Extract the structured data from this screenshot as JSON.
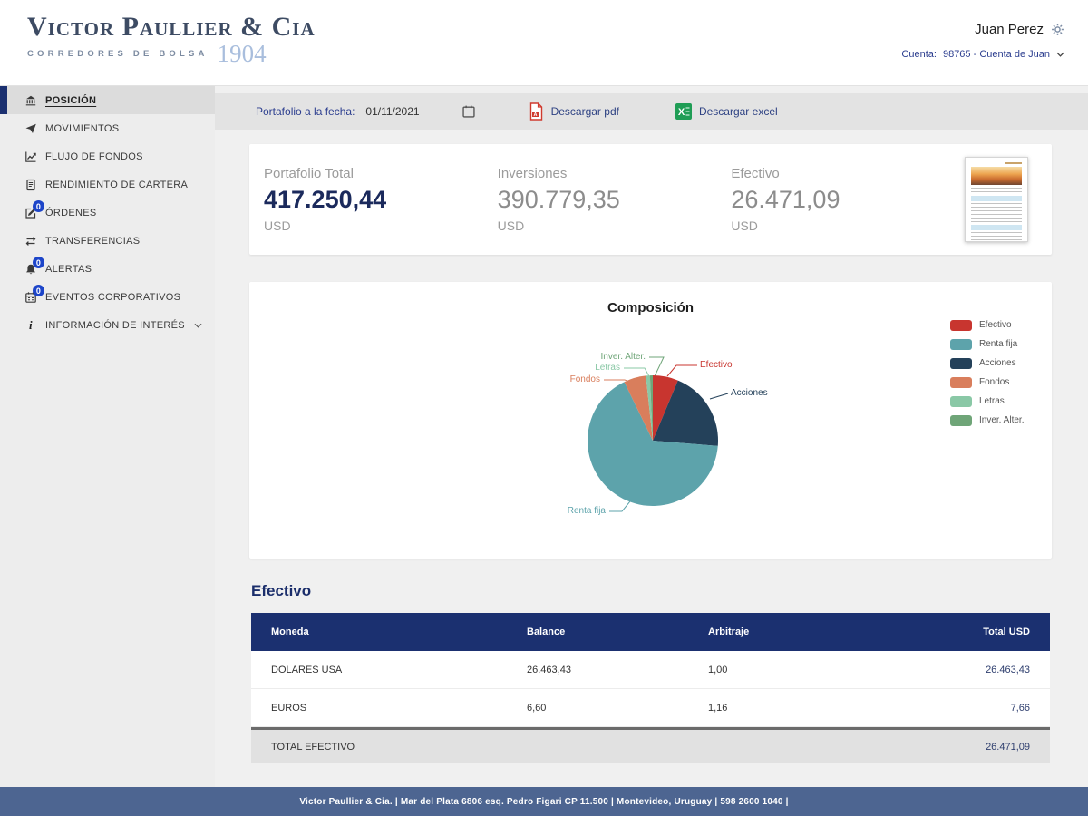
{
  "header": {
    "logo": {
      "name": "Victor Paullier & Cia",
      "tagline": "CORREDORES DE BOLSA",
      "year": "1904"
    },
    "user": {
      "name": "Juan Perez",
      "gear_icon": "gear-icon",
      "account_label": "Cuenta:",
      "account_value": "98765 - Cuenta de Juan"
    }
  },
  "sidebar": {
    "items": [
      {
        "label": "POSICIÓN",
        "icon": "bank-icon",
        "active": true
      },
      {
        "label": "MOVIMIENTOS",
        "icon": "send-icon"
      },
      {
        "label": "FLUJO DE FONDOS",
        "icon": "chart-line-icon"
      },
      {
        "label": "RENDIMIENTO DE CARTERA",
        "icon": "report-icon"
      },
      {
        "label": "ÓRDENES",
        "icon": "pencil-icon",
        "badge": "0"
      },
      {
        "label": "TRANSFERENCIAS",
        "icon": "transfer-icon"
      },
      {
        "label": "ALERTAS",
        "icon": "bell-icon",
        "badge": "0"
      },
      {
        "label": "EVENTOS CORPORATIVOS",
        "icon": "calendar-icon",
        "badge": "0"
      },
      {
        "label": "INFORMACIÓN DE INTERÉS",
        "icon": "info-icon",
        "chevron": "chevron-down-icon"
      }
    ]
  },
  "toolbar": {
    "date_label": "Portafolio a la fecha:",
    "date_value": "01/11/2021",
    "calendar_icon": "calendar-icon",
    "pdf_icon": "pdf-file-icon",
    "download_pdf_label": "Descargar pdf",
    "excel_icon": "excel-file-icon",
    "download_excel_label": "Descargar excel"
  },
  "summary": {
    "cards": [
      {
        "label": "Portafolio Total",
        "value": "417.250,44",
        "currency": "USD"
      },
      {
        "label": "Inversiones",
        "value": "390.779,35",
        "currency": "USD"
      },
      {
        "label": "Efectivo",
        "value": "26.471,09",
        "currency": "USD"
      }
    ],
    "thumbnail": "report-document-thumbnail"
  },
  "chart_data": {
    "type": "pie",
    "title": "Composición",
    "legend_position": "right",
    "slices": [
      {
        "label": "Efectivo",
        "value": 6.3,
        "color": "#c8352f"
      },
      {
        "label": "Acciones",
        "value": 20.0,
        "color": "#24415a"
      },
      {
        "label": "Renta fija",
        "value": 66.5,
        "color": "#5da3ab"
      },
      {
        "label": "Fondos",
        "value": 5.5,
        "color": "#d97e5c"
      },
      {
        "label": "Letras",
        "value": 1.0,
        "color": "#8ac8a6"
      },
      {
        "label": "Inver. Alter.",
        "value": 0.7,
        "color": "#6fa578"
      }
    ],
    "legend": [
      {
        "label": "Efectivo",
        "color": "#c8352f"
      },
      {
        "label": "Renta fija",
        "color": "#5da3ab"
      },
      {
        "label": "Acciones",
        "color": "#24415a"
      },
      {
        "label": "Fondos",
        "color": "#d97e5c"
      },
      {
        "label": "Letras",
        "color": "#8ac8a6"
      },
      {
        "label": "Inver. Alter.",
        "color": "#6fa578"
      }
    ]
  },
  "cash_section": {
    "title": "Efectivo",
    "table": {
      "headers": [
        "Moneda",
        "Balance",
        "Arbitraje",
        "Total USD"
      ],
      "rows": [
        [
          "DOLARES USA",
          "26.463,43",
          "1,00",
          "26.463,43"
        ],
        [
          "EUROS",
          "6,60",
          "1,16",
          "7,66"
        ]
      ],
      "total_label": "TOTAL EFECTIVO",
      "total_value": "26.471,09"
    }
  },
  "footer": {
    "text": "Victor Paullier & Cia. | Mar del Plata 6806 esq. Pedro Figari CP 11.500 | Montevideo, Uruguay | 598 2600 1040 |"
  }
}
